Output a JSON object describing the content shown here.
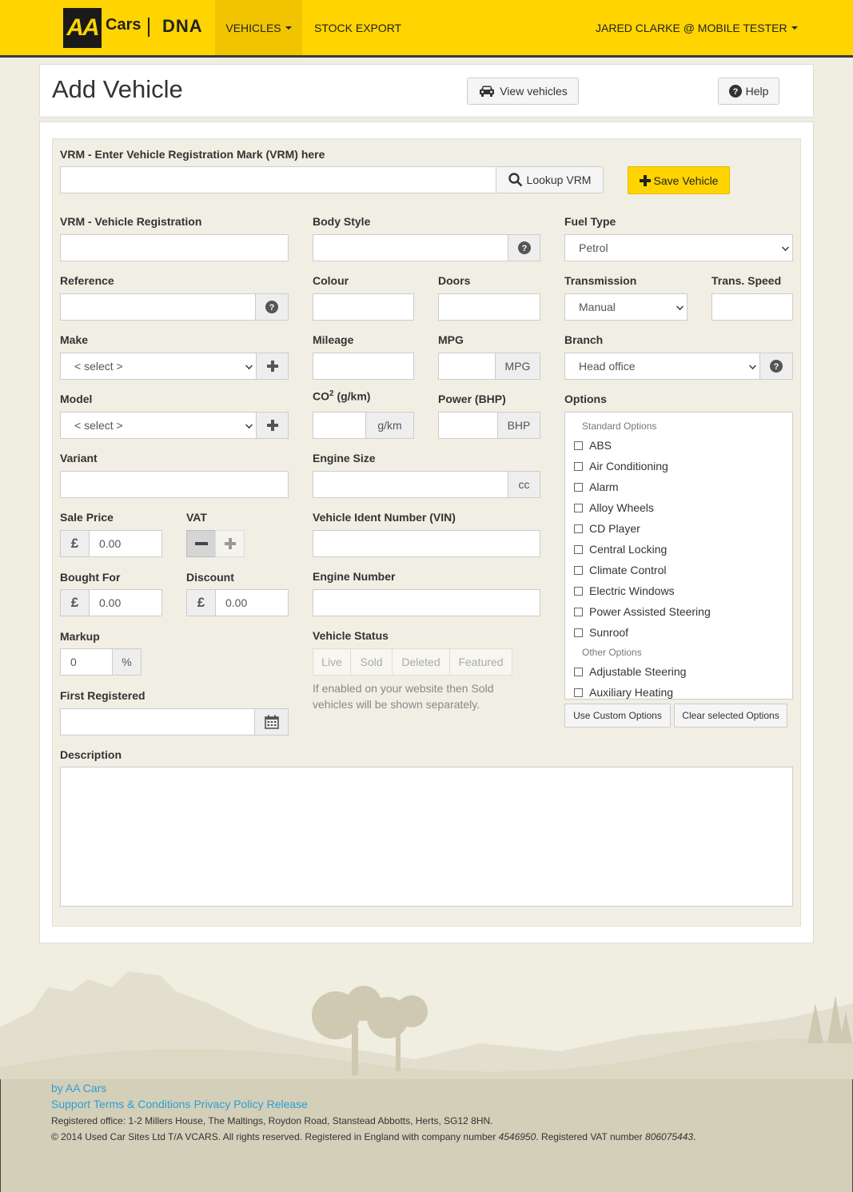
{
  "nav": {
    "logo": "AA",
    "brand_cars": "Cars",
    "brand_dna": "DNA",
    "vehicles": "VEHICLES",
    "stock_export": "STOCK EXPORT",
    "user": "JARED CLARKE @ MOBILE TESTER"
  },
  "header": {
    "title": "Add Vehicle",
    "view_vehicles": "View vehicles",
    "help": "Help"
  },
  "form": {
    "vrm_lookup_label": "VRM - Enter Vehicle Registration Mark (VRM) here",
    "vrm_lookup_value": "",
    "lookup_button": "Lookup VRM",
    "save_button": "Save Vehicle",
    "vrm_label": "VRM - Vehicle Registration",
    "vrm_value": "",
    "body_style_label": "Body Style",
    "fuel_type_label": "Fuel Type",
    "fuel_type_value": "Petrol",
    "reference_label": "Reference",
    "colour_label": "Colour",
    "doors_label": "Doors",
    "transmission_label": "Transmission",
    "transmission_value": "Manual",
    "trans_speed_label": "Trans. Speed",
    "make_label": "Make",
    "make_value": "< select >",
    "mileage_label": "Mileage",
    "mpg_label": "MPG",
    "mpg_unit": "MPG",
    "branch_label": "Branch",
    "branch_value": "Head office",
    "model_label": "Model",
    "model_value": "< select >",
    "co2_label": "CO",
    "co2_sup": "2",
    "co2_label_suffix": " (g/km)",
    "co2_unit": "g/km",
    "power_label": "Power (BHP)",
    "power_unit": "BHP",
    "options_label": "Options",
    "variant_label": "Variant",
    "engine_size_label": "Engine Size",
    "engine_size_unit": "cc",
    "sale_price_label": "Sale Price",
    "sale_price_value": "0.00",
    "currency": "£",
    "vat_label": "VAT",
    "vin_label": "Vehicle Ident Number (VIN)",
    "bought_for_label": "Bought For",
    "bought_for_value": "0.00",
    "discount_label": "Discount",
    "discount_value": "0.00",
    "engine_number_label": "Engine Number",
    "markup_label": "Markup",
    "markup_value": "0",
    "markup_unit": "%",
    "vehicle_status_label": "Vehicle Status",
    "status_options": [
      "Live",
      "Sold",
      "Deleted",
      "Featured"
    ],
    "status_help": "If enabled on your website then Sold vehicles will be shown separately.",
    "first_registered_label": "First Registered",
    "description_label": "Description",
    "use_custom_options": "Use Custom Options",
    "clear_options": "Clear selected Options"
  },
  "options": {
    "standard_heading": "Standard Options",
    "standard": [
      "ABS",
      "Air Conditioning",
      "Alarm",
      "Alloy Wheels",
      "CD Player",
      "Central Locking",
      "Climate Control",
      "Electric Windows",
      "Power Assisted Steering",
      "Sunroof"
    ],
    "other_heading": "Other Options",
    "other": [
      "Adjustable Steering",
      "Auxiliary Heating"
    ]
  },
  "footer": {
    "by": "by AA Cars",
    "support": "Support",
    "terms": "Terms & Conditions",
    "privacy": "Privacy Policy",
    "release": "Release",
    "office": "Registered office: 1-2 Millers House, The Maltings, Roydon Road, Stanstead Abbotts, Herts, SG12 8HN.",
    "copyright_prefix": "© 2014 Used Car Sites Ltd T/A VCARS. All rights reserved. Registered in England with company number ",
    "company_number": "4546950",
    "vat_prefix": ". Registered VAT number ",
    "vat_number": "806075443",
    "suffix": "."
  },
  "colors": {
    "brand": "#ffd400",
    "link": "#2a9fd6"
  }
}
